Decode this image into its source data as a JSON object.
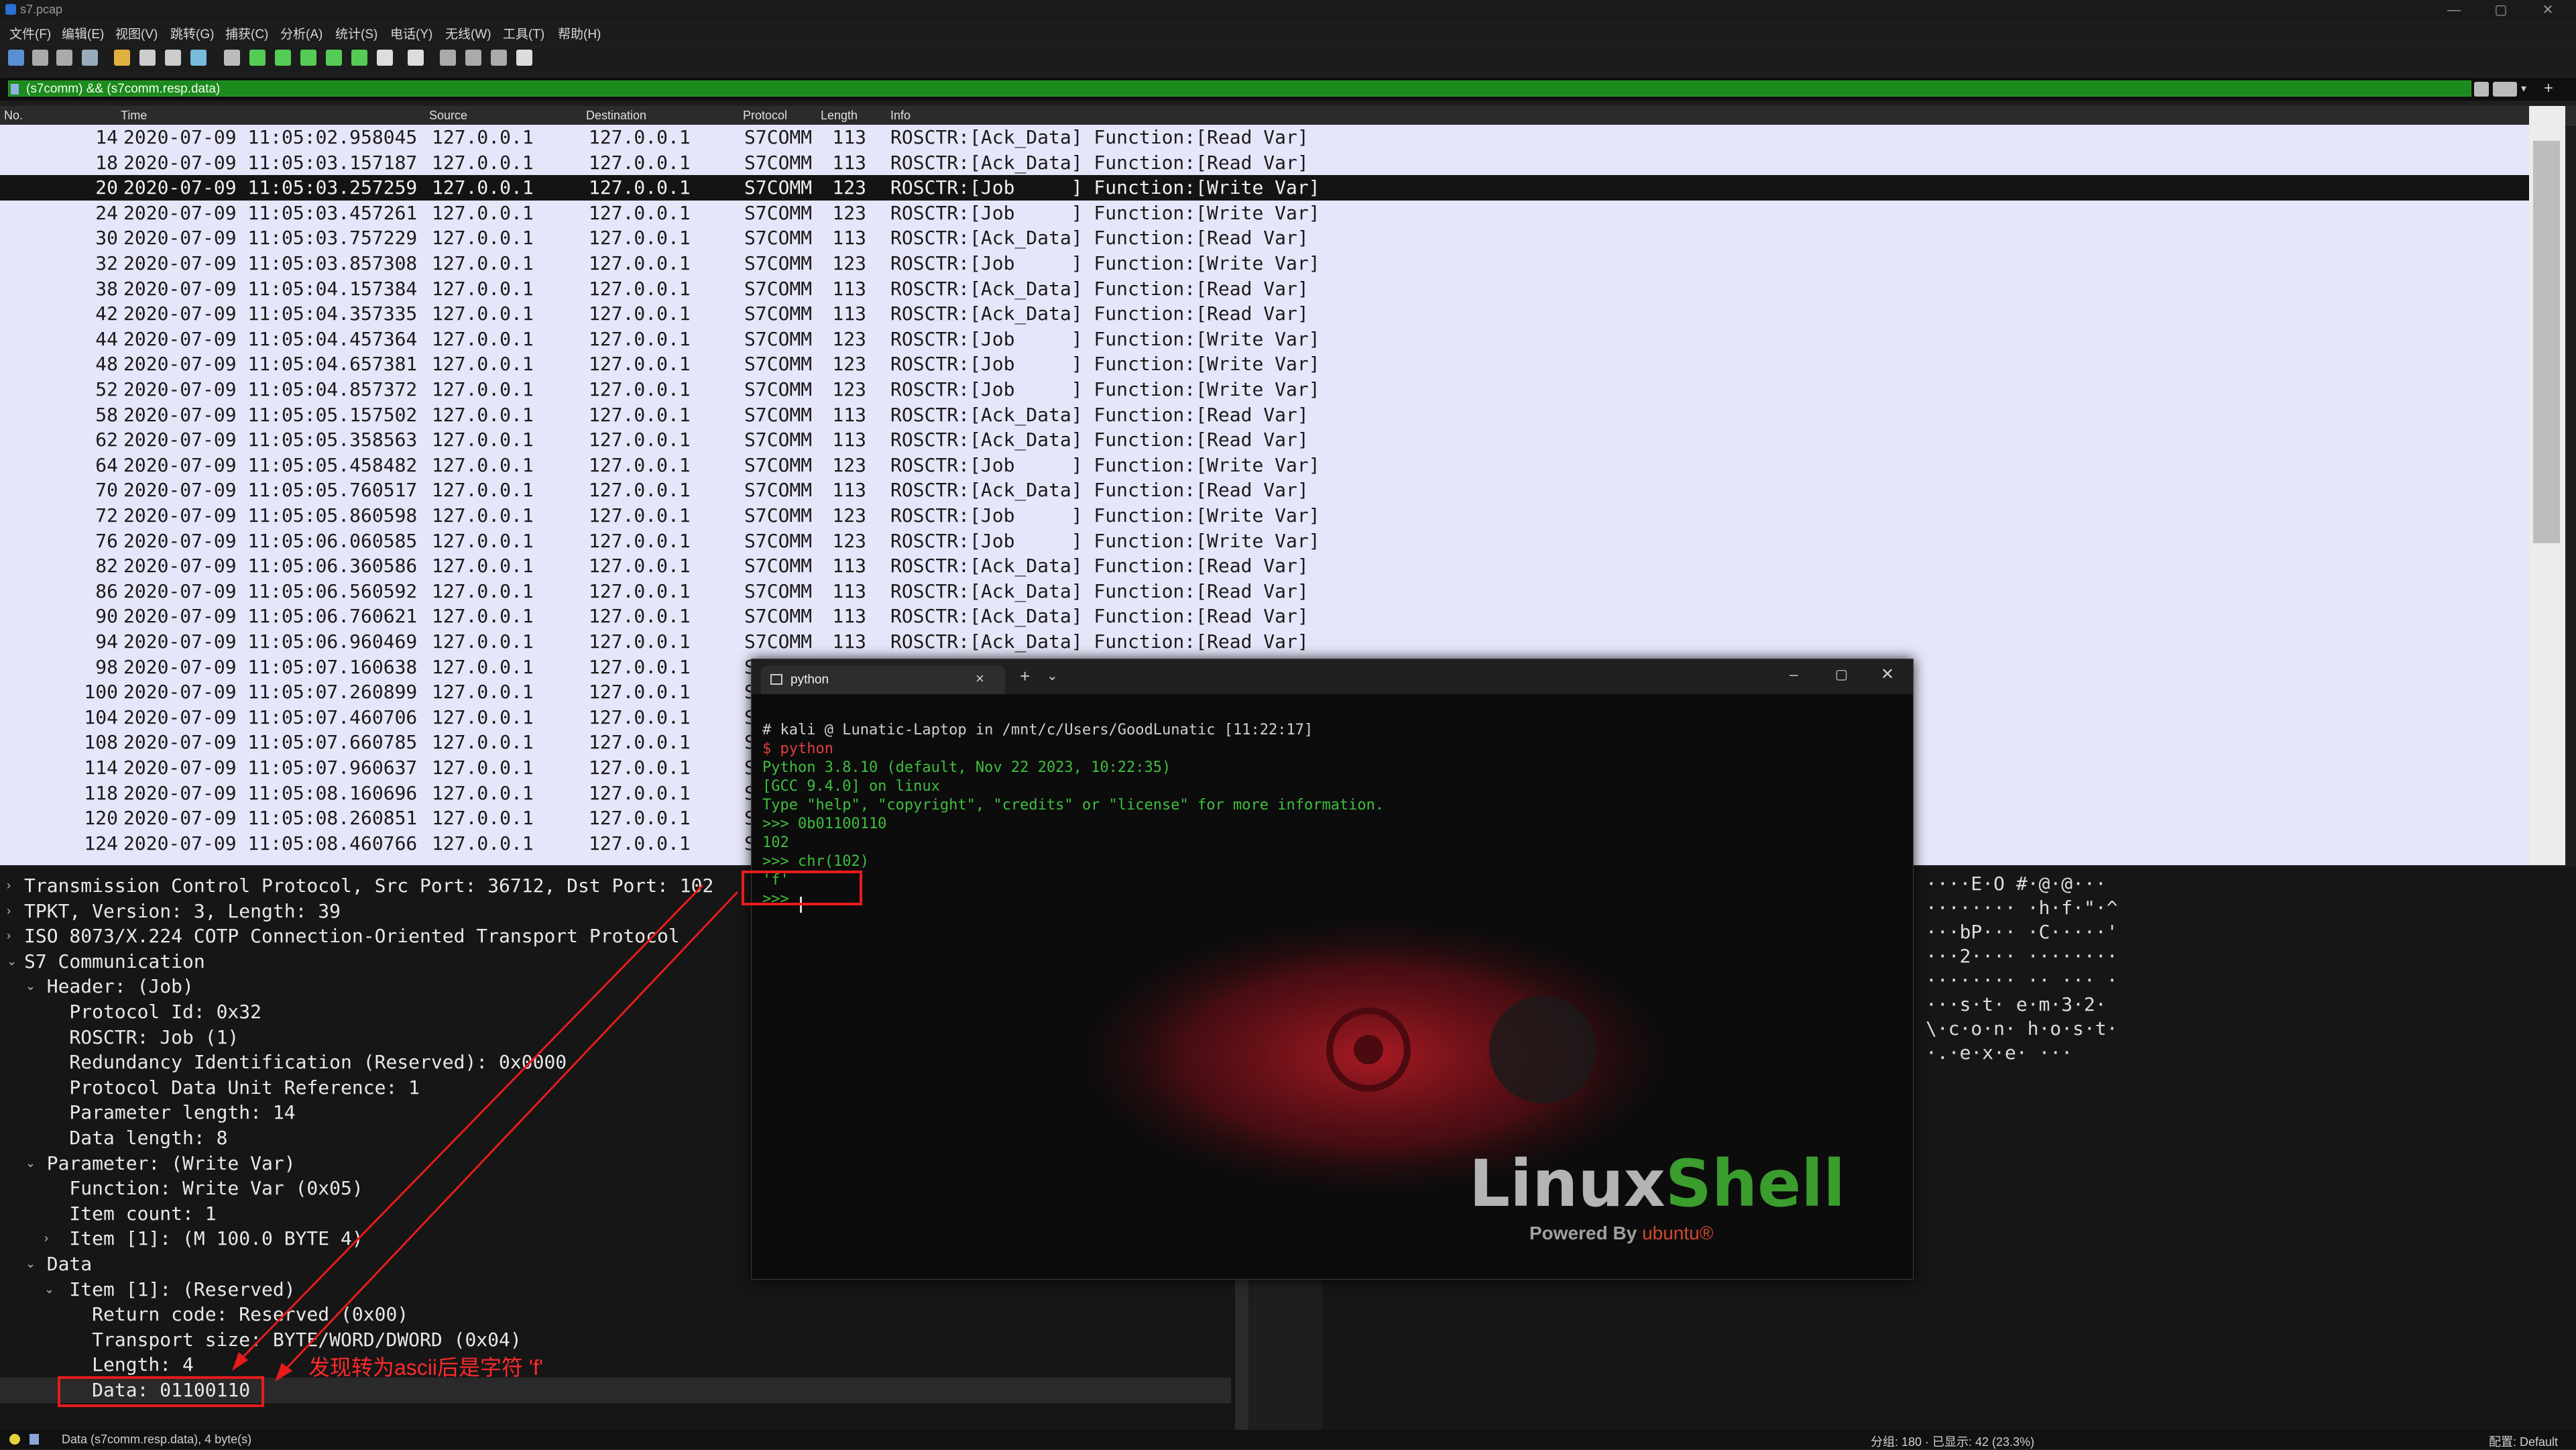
{
  "window": {
    "title": "s7.pcap",
    "controls": [
      "—",
      "▢",
      "✕"
    ]
  },
  "menu": [
    "文件(F)",
    "编辑(E)",
    "视图(V)",
    "跳转(G)",
    "捕获(C)",
    "分析(A)",
    "统计(S)",
    "电话(Y)",
    "无线(W)",
    "工具(T)",
    "帮助(H)"
  ],
  "filter": {
    "value": "(s7comm) && (s7comm.resp.data)"
  },
  "columns": [
    "No.",
    "Time",
    "Source",
    "Destination",
    "Protocol",
    "Length",
    "Info"
  ],
  "packets": [
    {
      "no": "14",
      "time": "2020-07-09 11:05:02.958045",
      "src": "127.0.0.1",
      "dst": "127.0.0.1",
      "proto": "S7COMM",
      "len": "113",
      "info": "ROSCTR:[Ack_Data] Function:[Read Var]"
    },
    {
      "no": "18",
      "time": "2020-07-09 11:05:03.157187",
      "src": "127.0.0.1",
      "dst": "127.0.0.1",
      "proto": "S7COMM",
      "len": "113",
      "info": "ROSCTR:[Ack_Data] Function:[Read Var]"
    },
    {
      "no": "20",
      "time": "2020-07-09 11:05:03.257259",
      "src": "127.0.0.1",
      "dst": "127.0.0.1",
      "proto": "S7COMM",
      "len": "123",
      "info": "ROSCTR:[Job     ] Function:[Write Var]",
      "selected": true
    },
    {
      "no": "24",
      "time": "2020-07-09 11:05:03.457261",
      "src": "127.0.0.1",
      "dst": "127.0.0.1",
      "proto": "S7COMM",
      "len": "123",
      "info": "ROSCTR:[Job     ] Function:[Write Var]"
    },
    {
      "no": "30",
      "time": "2020-07-09 11:05:03.757229",
      "src": "127.0.0.1",
      "dst": "127.0.0.1",
      "proto": "S7COMM",
      "len": "113",
      "info": "ROSCTR:[Ack_Data] Function:[Read Var]"
    },
    {
      "no": "32",
      "time": "2020-07-09 11:05:03.857308",
      "src": "127.0.0.1",
      "dst": "127.0.0.1",
      "proto": "S7COMM",
      "len": "123",
      "info": "ROSCTR:[Job     ] Function:[Write Var]"
    },
    {
      "no": "38",
      "time": "2020-07-09 11:05:04.157384",
      "src": "127.0.0.1",
      "dst": "127.0.0.1",
      "proto": "S7COMM",
      "len": "113",
      "info": "ROSCTR:[Ack_Data] Function:[Read Var]"
    },
    {
      "no": "42",
      "time": "2020-07-09 11:05:04.357335",
      "src": "127.0.0.1",
      "dst": "127.0.0.1",
      "proto": "S7COMM",
      "len": "113",
      "info": "ROSCTR:[Ack_Data] Function:[Read Var]"
    },
    {
      "no": "44",
      "time": "2020-07-09 11:05:04.457364",
      "src": "127.0.0.1",
      "dst": "127.0.0.1",
      "proto": "S7COMM",
      "len": "123",
      "info": "ROSCTR:[Job     ] Function:[Write Var]"
    },
    {
      "no": "48",
      "time": "2020-07-09 11:05:04.657381",
      "src": "127.0.0.1",
      "dst": "127.0.0.1",
      "proto": "S7COMM",
      "len": "123",
      "info": "ROSCTR:[Job     ] Function:[Write Var]"
    },
    {
      "no": "52",
      "time": "2020-07-09 11:05:04.857372",
      "src": "127.0.0.1",
      "dst": "127.0.0.1",
      "proto": "S7COMM",
      "len": "123",
      "info": "ROSCTR:[Job     ] Function:[Write Var]"
    },
    {
      "no": "58",
      "time": "2020-07-09 11:05:05.157502",
      "src": "127.0.0.1",
      "dst": "127.0.0.1",
      "proto": "S7COMM",
      "len": "113",
      "info": "ROSCTR:[Ack_Data] Function:[Read Var]"
    },
    {
      "no": "62",
      "time": "2020-07-09 11:05:05.358563",
      "src": "127.0.0.1",
      "dst": "127.0.0.1",
      "proto": "S7COMM",
      "len": "113",
      "info": "ROSCTR:[Ack_Data] Function:[Read Var]"
    },
    {
      "no": "64",
      "time": "2020-07-09 11:05:05.458482",
      "src": "127.0.0.1",
      "dst": "127.0.0.1",
      "proto": "S7COMM",
      "len": "123",
      "info": "ROSCTR:[Job     ] Function:[Write Var]"
    },
    {
      "no": "70",
      "time": "2020-07-09 11:05:05.760517",
      "src": "127.0.0.1",
      "dst": "127.0.0.1",
      "proto": "S7COMM",
      "len": "113",
      "info": "ROSCTR:[Ack_Data] Function:[Read Var]"
    },
    {
      "no": "72",
      "time": "2020-07-09 11:05:05.860598",
      "src": "127.0.0.1",
      "dst": "127.0.0.1",
      "proto": "S7COMM",
      "len": "123",
      "info": "ROSCTR:[Job     ] Function:[Write Var]"
    },
    {
      "no": "76",
      "time": "2020-07-09 11:05:06.060585",
      "src": "127.0.0.1",
      "dst": "127.0.0.1",
      "proto": "S7COMM",
      "len": "123",
      "info": "ROSCTR:[Job     ] Function:[Write Var]"
    },
    {
      "no": "82",
      "time": "2020-07-09 11:05:06.360586",
      "src": "127.0.0.1",
      "dst": "127.0.0.1",
      "proto": "S7COMM",
      "len": "113",
      "info": "ROSCTR:[Ack_Data] Function:[Read Var]"
    },
    {
      "no": "86",
      "time": "2020-07-09 11:05:06.560592",
      "src": "127.0.0.1",
      "dst": "127.0.0.1",
      "proto": "S7COMM",
      "len": "113",
      "info": "ROSCTR:[Ack_Data] Function:[Read Var]"
    },
    {
      "no": "90",
      "time": "2020-07-09 11:05:06.760621",
      "src": "127.0.0.1",
      "dst": "127.0.0.1",
      "proto": "S7COMM",
      "len": "113",
      "info": "ROSCTR:[Ack_Data] Function:[Read Var]"
    },
    {
      "no": "94",
      "time": "2020-07-09 11:05:06.960469",
      "src": "127.0.0.1",
      "dst": "127.0.0.1",
      "proto": "S7COMM",
      "len": "113",
      "info": "ROSCTR:[Ack_Data] Function:[Read Var]"
    },
    {
      "no": "98",
      "time": "2020-07-09 11:05:07.160638",
      "src": "127.0.0.1",
      "dst": "127.0.0.1",
      "proto": "S7COMM",
      "len": "",
      "info": ""
    },
    {
      "no": "100",
      "time": "2020-07-09 11:05:07.260899",
      "src": "127.0.0.1",
      "dst": "127.0.0.1",
      "proto": "S7COMM",
      "len": "",
      "info": ""
    },
    {
      "no": "104",
      "time": "2020-07-09 11:05:07.460706",
      "src": "127.0.0.1",
      "dst": "127.0.0.1",
      "proto": "S7COMM",
      "len": "",
      "info": ""
    },
    {
      "no": "108",
      "time": "2020-07-09 11:05:07.660785",
      "src": "127.0.0.1",
      "dst": "127.0.0.1",
      "proto": "S7COMM",
      "len": "",
      "info": ""
    },
    {
      "no": "114",
      "time": "2020-07-09 11:05:07.960637",
      "src": "127.0.0.1",
      "dst": "127.0.0.1",
      "proto": "S7COMM",
      "len": "",
      "info": ""
    },
    {
      "no": "118",
      "time": "2020-07-09 11:05:08.160696",
      "src": "127.0.0.1",
      "dst": "127.0.0.1",
      "proto": "S7COMM",
      "len": "",
      "info": ""
    },
    {
      "no": "120",
      "time": "2020-07-09 11:05:08.260851",
      "src": "127.0.0.1",
      "dst": "127.0.0.1",
      "proto": "S7COMM",
      "len": "",
      "info": ""
    },
    {
      "no": "124",
      "time": "2020-07-09 11:05:08.460766",
      "src": "127.0.0.1",
      "dst": "127.0.0.1",
      "proto": "S7COMM",
      "len": "",
      "info": ""
    }
  ],
  "details": [
    {
      "text": "Transmission Control Protocol, Src Port: 36712, Dst Port: 102",
      "arrow": "›"
    },
    {
      "text": "TPKT, Version: 3, Length: 39",
      "arrow": "›"
    },
    {
      "text": "ISO 8073/X.224 COTP Connection-Oriented Transport Protocol",
      "arrow": "›"
    },
    {
      "text": "S7 Communication",
      "arrow": "⌄"
    },
    {
      "text": "  Header: (Job)",
      "arrow": "⌄"
    },
    {
      "text": "    Protocol Id: 0x32",
      "arrow": ""
    },
    {
      "text": "    ROSCTR: Job (1)",
      "arrow": ""
    },
    {
      "text": "    Redundancy Identification (Reserved): 0x0000",
      "arrow": ""
    },
    {
      "text": "    Protocol Data Unit Reference: 1",
      "arrow": ""
    },
    {
      "text": "    Parameter length: 14",
      "arrow": ""
    },
    {
      "text": "    Data length: 8",
      "arrow": ""
    },
    {
      "text": "  Parameter: (Write Var)",
      "arrow": "⌄"
    },
    {
      "text": "    Function: Write Var (0x05)",
      "arrow": ""
    },
    {
      "text": "    Item count: 1",
      "arrow": ""
    },
    {
      "text": "    Item [1]: (M 100.0 BYTE 4)",
      "arrow": "›"
    },
    {
      "text": "  Data",
      "arrow": "⌄"
    },
    {
      "text": "    Item [1]: (Reserved)",
      "arrow": "⌄"
    },
    {
      "text": "      Return code: Reserved (0x00)",
      "arrow": ""
    },
    {
      "text": "      Transport size: BYTE/WORD/DWORD (0x04)",
      "arrow": ""
    },
    {
      "text": "      Length: 4",
      "arrow": ""
    },
    {
      "text": "      Data: 01100110",
      "arrow": ""
    }
  ],
  "bytes_ascii": [
    "····E·O #·@·@···",
    "········ ·h·f·\"·^",
    "···bP··· ·C·····'",
    "···2···· ········",
    "········ ·· ··· ·",
    "···s·t· e·m·3·2·",
    "\\·c·o·n· h·o·s·t·",
    "·.·e·x·e· ···"
  ],
  "terminal": {
    "tab_title": "python",
    "lines": [
      {
        "text": "# kali @ Lunatic-Laptop in /mnt/c/Users/GoodLunatic [11:22:17]",
        "color": "#cfcfcf"
      },
      {
        "text": "$ python",
        "color": "#e04040"
      },
      {
        "text": "Python 3.8.10 (default, Nov 22 2023, 10:22:35)",
        "color": "#3fbf3f"
      },
      {
        "text": "[GCC 9.4.0] on linux",
        "color": "#3fbf3f"
      },
      {
        "text": "Type \"help\", \"copyright\", \"credits\" or \"license\" for more information.",
        "color": "#3fbf3f"
      },
      {
        "text": ">>> 0b01100110",
        "color": "#3fbf3f"
      },
      {
        "text": "102",
        "color": "#3fbf3f"
      },
      {
        "text": ">>> chr(102)",
        "color": "#3fbf3f"
      },
      {
        "text": "'f'",
        "color": "#3fbf3f"
      },
      {
        "text": ">>> ",
        "color": "#3fbf3f"
      }
    ],
    "logo_text_a": "Linux",
    "logo_text_b": "Shell",
    "logo_sub_a": "Powered By",
    "logo_sub_b": "ubuntu®"
  },
  "annotation": "发现转为ascii后是字符 'f'",
  "status": {
    "left": "Data (s7comm.resp.data), 4 byte(s)",
    "middle": "分组: 180 · 已显示: 42 (23.3%)",
    "right": "配置: Default"
  },
  "colors": {
    "filter_ok": "#1c8a1c",
    "annotation_red": "#e81b1b",
    "terminal_green": "#3fbf3f"
  }
}
